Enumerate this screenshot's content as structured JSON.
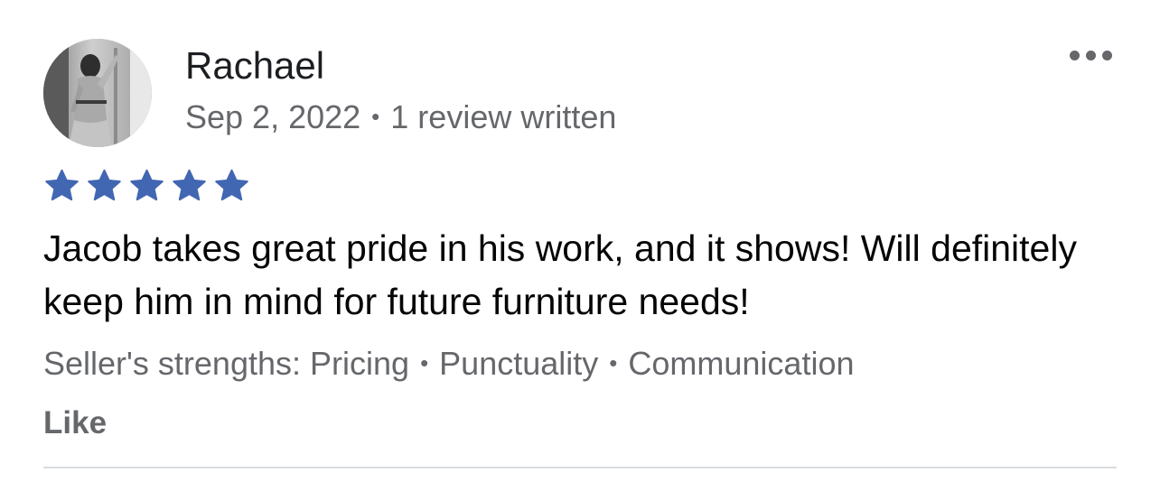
{
  "review": {
    "reviewer_name": "Rachael",
    "date": "Sep 2, 2022",
    "separator": "•",
    "review_count": "1 review written",
    "rating": 5,
    "rating_max": 5,
    "text": "Jacob takes great pride in his work, and it shows! Will definitely keep him in mind for future furniture needs!",
    "strengths_label": "Seller's strengths:",
    "strengths": [
      "Pricing",
      "Punctuality",
      "Communication"
    ],
    "like_label": "Like"
  },
  "icons": {
    "more": "more-options-icon",
    "star": "star-icon",
    "avatar": "reviewer-photo"
  },
  "colors": {
    "star": "#4267b2",
    "primary_text": "#050505",
    "secondary_text": "#65676b",
    "divider": "#dadde1"
  }
}
